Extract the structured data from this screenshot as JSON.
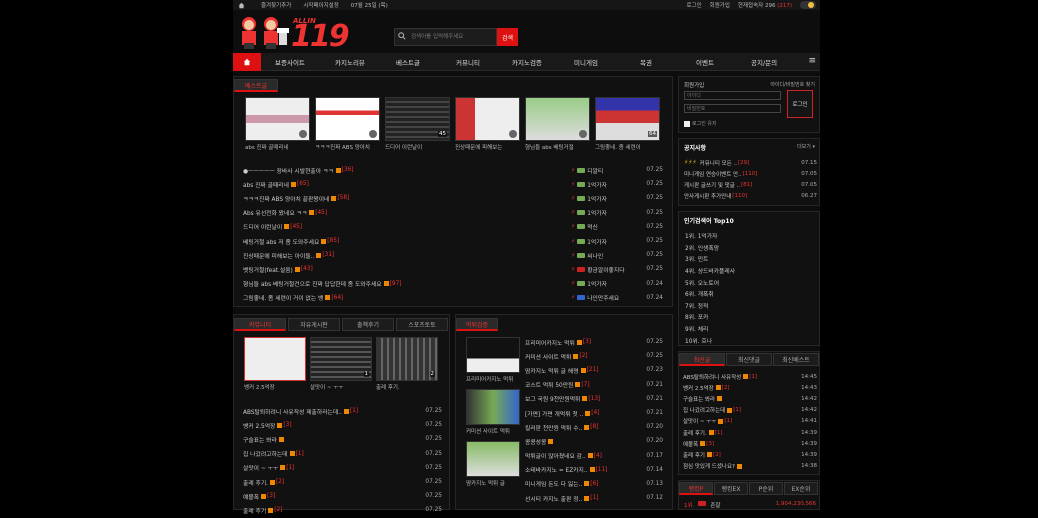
{
  "topbar": {
    "left": [
      "즐겨찾기추가",
      "시작페이지설정",
      "07월 25일 (목)"
    ],
    "right": [
      "로그인",
      "회원가입"
    ],
    "visitors": "현재접속자 296",
    "visitors_count": "(217)"
  },
  "logo": {
    "small": "ALLIN",
    "big": "119"
  },
  "search": {
    "placeholder": "검색어를 입력해주세요",
    "button": "검색"
  },
  "nav": [
    "보증사이트",
    "카지노리뷰",
    "베스트글",
    "커뮤니티",
    "카지노검증",
    "미니게임",
    "복권",
    "이벤트",
    "공지/문의"
  ],
  "best": {
    "tab": "베스트글",
    "thumbs": [
      {
        "cap": "abs 진짜 골때리네",
        "count": ""
      },
      {
        "cap": "ㅋㅋㅋ진짜 ABS 양아치",
        "count": ""
      },
      {
        "cap": "드디어 이런날이",
        "count": "45"
      },
      {
        "cap": "진상때문에 피해보는",
        "count": ""
      },
      {
        "cap": "형님들 abs 베팅거절",
        "count": ""
      },
      {
        "cap": "그림좋네. 좀 세련이",
        "count": "64"
      }
    ],
    "rows": [
      {
        "t": "●ㅡㅡㅡㅡㅡ 장바사 시발현출아 ㅋㅋ",
        "c": "[36]",
        "u": "디알티",
        "d": "07.25"
      },
      {
        "t": "abs 진짜 골때리네",
        "c": "[65]",
        "u": "1억가자",
        "d": "07.25"
      },
      {
        "t": "ㅋㅋㅋ진짜 ABS 양아치 끝판왕이네",
        "c": "[58]",
        "u": "1억가자",
        "d": "07.25"
      },
      {
        "t": "Abs 유선전화 왔네요 ㅋㅋ",
        "c": "[45]",
        "u": "1억가자",
        "d": "07.25"
      },
      {
        "t": "드디어 이런날이",
        "c": "[45]",
        "u": "먹신",
        "d": "07.25"
      },
      {
        "t": "베팅거절 abs 저 좀 도와주세요",
        "c": "[85]",
        "u": "1억가자",
        "d": "07.25"
      },
      {
        "t": "진상때문에 피해보는 아이들..",
        "c": "[31]",
        "u": "씨나인",
        "d": "07.25"
      },
      {
        "t": "벳팅거절(feat.설움)",
        "c": "[43]",
        "u": "황금알이좋지다",
        "d": "07.25"
      },
      {
        "t": "형님들 abs 베팅거절건으로 진짜 답답한데 좀 도와주세요",
        "c": "[97]",
        "u": "1억가자",
        "d": "07.24"
      },
      {
        "t": "그림좋네. 좀 세련이 거이 없는 뱅",
        "c": "[64]",
        "u": "나인만주세요",
        "d": "07.24"
      }
    ]
  },
  "community": {
    "tabs": [
      "커뮤니티",
      "자유게시판",
      "출첵후기",
      "스포츠토토"
    ],
    "thumbs": [
      {
        "cap": "뱅커 2.5억장",
        "count": ""
      },
      {
        "cap": "살맛이 ~ ㅜㅜ",
        "count": "1"
      },
      {
        "cap": "출례 후기.",
        "count": "2"
      }
    ],
    "rows": [
      {
        "t": "ABS탈퇴하려니 사유작성 제출하라는데..",
        "c": "[1]",
        "d": "07.25"
      },
      {
        "t": "뱅커 2.5억장",
        "c": "[3]",
        "d": "07.25"
      },
      {
        "t": "구슬표는 봐라",
        "c": "",
        "d": "07.25"
      },
      {
        "t": "집 나갔려고하는데",
        "c": "[1]",
        "d": "07.25"
      },
      {
        "t": "살맛이 ~ ㅜㅜ",
        "c": "[1]",
        "d": "07.25"
      },
      {
        "t": "출례 후기.",
        "c": "[2]",
        "d": "07.25"
      },
      {
        "t": "예볼폭",
        "c": "[3]",
        "d": "07.25"
      },
      {
        "t": "출례 후기",
        "c": "[2]",
        "d": "07.25"
      }
    ]
  },
  "verify": {
    "tab": "먹튀검증",
    "thumbs": [
      {
        "cap": "프리미어카지노 먹튀"
      },
      {
        "cap": "커미션 사이트 먹튀"
      },
      {
        "cap": "땀카지노 먹튀 글"
      }
    ],
    "rows": [
      {
        "t": "프리미어카지노 먹튀",
        "c": "[3]",
        "d": "07.25"
      },
      {
        "t": "커미션 사이트 먹튀",
        "c": "[2]",
        "d": "07.25"
      },
      {
        "t": "땀카지노 먹튀 글 해명",
        "c": "[21]",
        "d": "07.23"
      },
      {
        "t": "코스트 먹튀 50만원",
        "c": "[7]",
        "d": "07.21"
      },
      {
        "t": "보그 국원 9천만원먹튀",
        "c": "[13]",
        "d": "07.21"
      },
      {
        "t": "[가면] 가면 개먹튀 첫 ..",
        "c": "[4]",
        "d": "07.21"
      },
      {
        "t": "킬러판 천만원 먹튀 수..",
        "c": "[8]",
        "d": "07.20"
      },
      {
        "t": "콩콩성콩",
        "c": "",
        "d": "07.20"
      },
      {
        "t": "먹튀글이 많아졌네요 감..",
        "c": "[4]",
        "d": "07.17"
      },
      {
        "t": "소테바카지노 = EZ카지..",
        "c": "[11]",
        "d": "07.14"
      },
      {
        "t": "미니게임 돈도 다 잃는..",
        "c": "[6]",
        "d": "07.13"
      },
      {
        "t": "선시티 카지노 출판 정..",
        "c": "[1]",
        "d": "07.12"
      }
    ]
  },
  "login": {
    "title": "회원가입",
    "find": "아이디/비밀번호 찾기",
    "id_ph": "아이디",
    "pw_ph": "비밀번호",
    "button": "로그인",
    "auto": "로그인 유지"
  },
  "notice": {
    "title": "공지사항",
    "more": "더보기",
    "rows": [
      {
        "t": "커뮤니티 모든 ..",
        "c": "[29]",
        "d": "07.15",
        "hot": true
      },
      {
        "t": "미니게임 연승이벤트 안..",
        "c": "[110]",
        "d": "07.05",
        "hot": false
      },
      {
        "t": "게시판 글쓰기 및 댓글 ..",
        "c": "[81]",
        "d": "07.05",
        "hot": false
      },
      {
        "t": "안사게시판 추가안내",
        "c": "[110]",
        "d": "06.27",
        "hot": false
      }
    ]
  },
  "keywords": {
    "title": "인기검색어 Top10",
    "items": [
      "1위. 1억가자",
      "2위. 인생폭망",
      "3위. 민트",
      "4위. 샹드바카플레사",
      "5위. 오노토어",
      "6위. 개폭취",
      "7위. 정적",
      "8위. 포카",
      "9위. 체리",
      "10위. 흐나"
    ]
  },
  "recent": {
    "tabs": [
      "최신글",
      "최신댓글",
      "최신베스트"
    ],
    "rows": [
      {
        "t": "ABS탈퇴하려니 사유작성",
        "c": "[1]",
        "d": "14:45"
      },
      {
        "t": "뱅커 2.5억장",
        "c": "[2]",
        "d": "14:43"
      },
      {
        "t": "구슬표는 봐라",
        "c": "",
        "d": "14:42"
      },
      {
        "t": "집 나갔려고하는데",
        "c": "[1]",
        "d": "14:42"
      },
      {
        "t": "살맛이 ~ ㅜㅜ",
        "c": "[1]",
        "d": "14:41"
      },
      {
        "t": "출례 후기.",
        "c": "[1]",
        "d": "14:39"
      },
      {
        "t": "예볼폭",
        "c": "[3]",
        "d": "14:39"
      },
      {
        "t": "출례 후기",
        "c": "[2]",
        "d": "14:39"
      },
      {
        "t": "점심 맛있게 드셨나요?",
        "c": "",
        "d": "14:38"
      }
    ]
  },
  "rank": {
    "tabs": [
      "랭킹P",
      "랭킹EX",
      "P순위",
      "EX순위"
    ],
    "first": "1위.",
    "first_user": "존잘",
    "first_val": "1,904,230,566"
  },
  "colors": {
    "accent": "#dd1111",
    "bg": "#0d0d0d"
  }
}
